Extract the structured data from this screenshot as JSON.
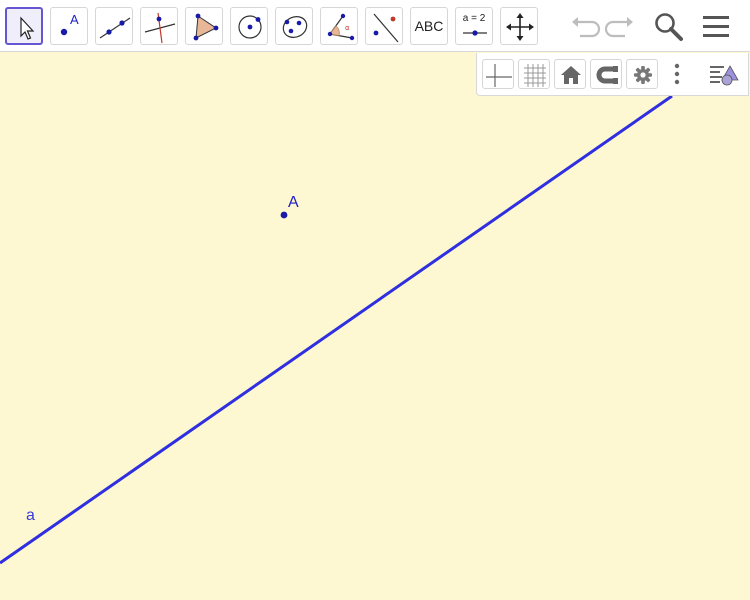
{
  "toolbar": {
    "tools": [
      {
        "id": "move",
        "icon": "cursor-arrow-icon",
        "selected": true
      },
      {
        "id": "point",
        "icon": "point-icon",
        "label": "A"
      },
      {
        "id": "line",
        "icon": "line-through-points-icon"
      },
      {
        "id": "perpendicular",
        "icon": "perpendicular-line-icon"
      },
      {
        "id": "polygon",
        "icon": "polygon-icon"
      },
      {
        "id": "circle",
        "icon": "circle-center-point-icon"
      },
      {
        "id": "conic",
        "icon": "conic-icon"
      },
      {
        "id": "angle",
        "icon": "angle-icon"
      },
      {
        "id": "reflect",
        "icon": "reflect-icon"
      },
      {
        "id": "text",
        "icon": "text-icon",
        "label": "ABC"
      },
      {
        "id": "slider",
        "icon": "slider-icon",
        "label": "a = 2"
      },
      {
        "id": "move-view",
        "icon": "move-graphics-view-icon"
      }
    ],
    "right_actions": [
      "undo-icon",
      "redo-icon",
      "search-icon",
      "menu-icon"
    ]
  },
  "style_bar": {
    "buttons": [
      "axes-icon",
      "grid-icon",
      "home-icon",
      "magnet-icon",
      "gear-icon"
    ],
    "more_icon": "more-vertical-icon",
    "toggle_icon": "style-bar-toggle-icon"
  },
  "graphics": {
    "point_label": "A",
    "line_label": "a",
    "colors": {
      "background": "#fdf8d1",
      "line": "#2f2fe0",
      "point": "#1a1aa8",
      "accent": "#6557d2"
    }
  }
}
